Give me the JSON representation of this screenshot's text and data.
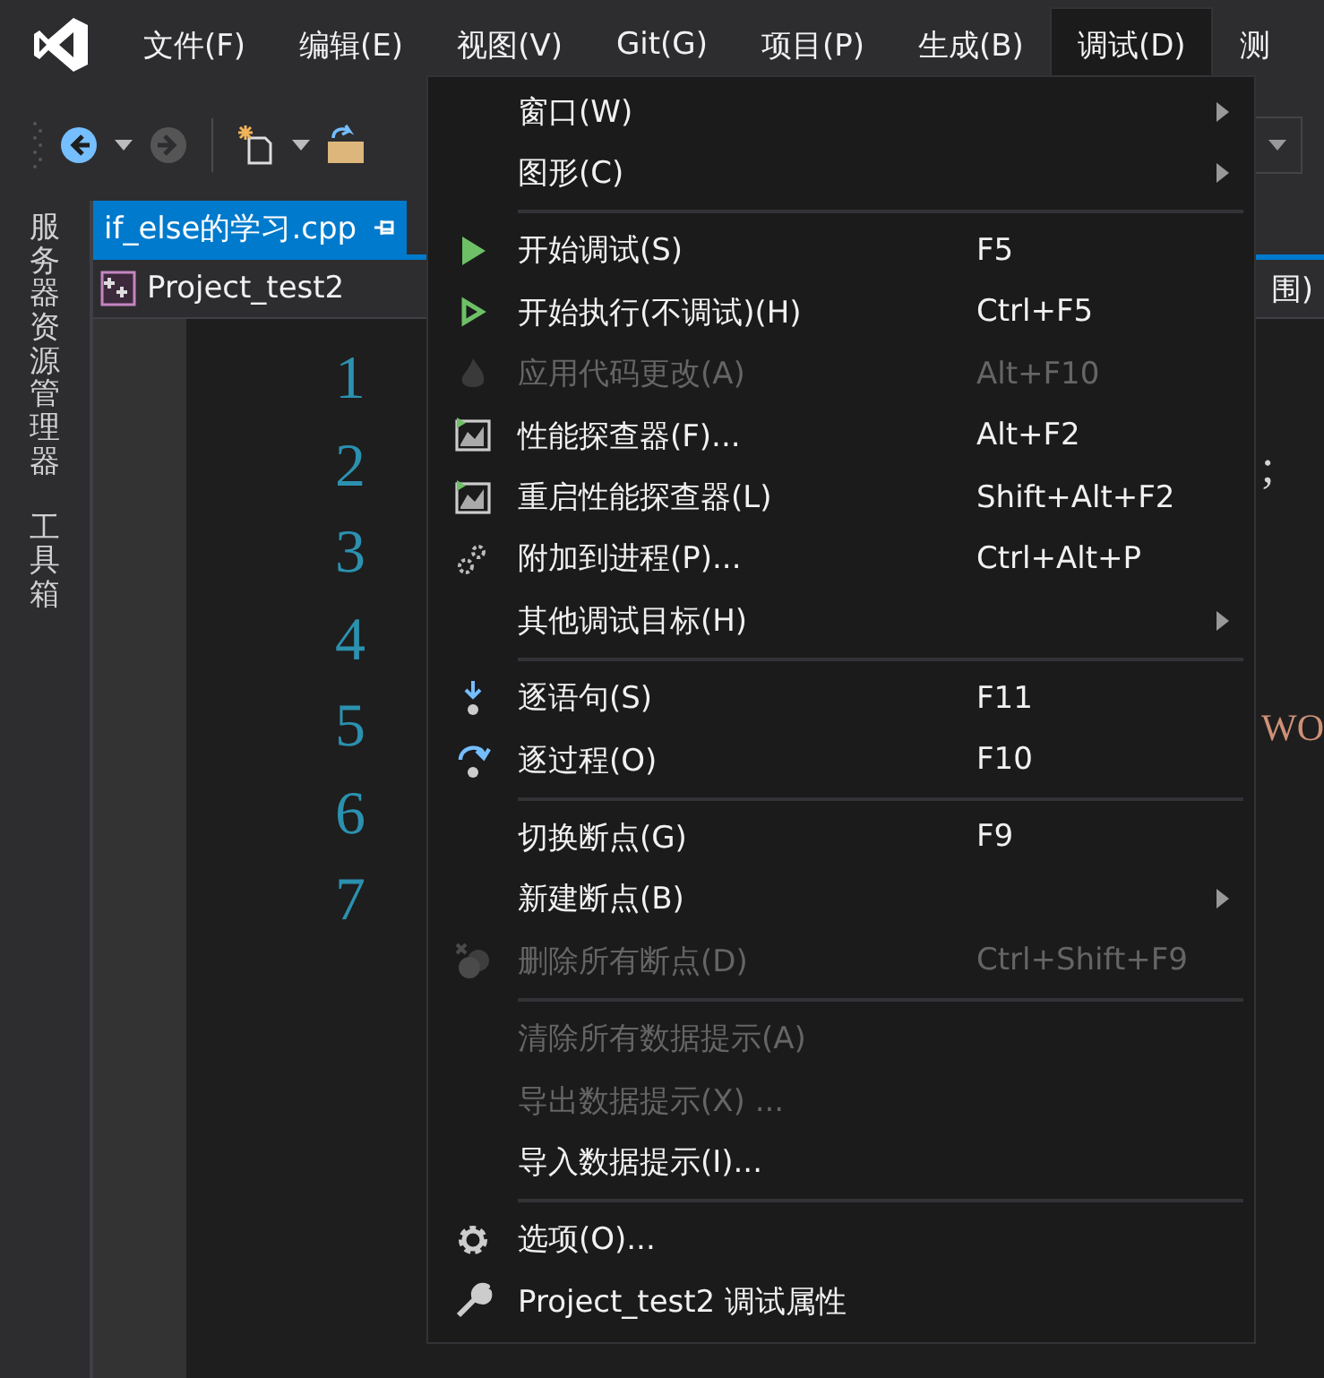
{
  "menu_bar": [
    {
      "label": "文件(F)",
      "selected": false
    },
    {
      "label": "编辑(E)",
      "selected": false
    },
    {
      "label": "视图(V)",
      "selected": false
    },
    {
      "label": "Git(G)",
      "selected": false
    },
    {
      "label": "项目(P)",
      "selected": false
    },
    {
      "label": "生成(B)",
      "selected": false
    },
    {
      "label": "调试(D)",
      "selected": true
    },
    {
      "label": "测",
      "selected": false
    }
  ],
  "side_tabs": [
    "服务器资源管理器",
    "工具箱"
  ],
  "document_tab": {
    "title": "if_else的学习.cpp",
    "selected": true
  },
  "nav_bar": {
    "project": "Project_test2",
    "scope": "围)"
  },
  "editor": {
    "lines": [
      {
        "number": "1"
      },
      {
        "number": "2",
        "text": ";"
      },
      {
        "number": "3"
      },
      {
        "number": "4"
      },
      {
        "number": "5",
        "text": "WO"
      },
      {
        "number": "6"
      },
      {
        "number": "7"
      }
    ]
  },
  "menu": {
    "items": [
      {
        "kind": "item",
        "label": "窗口(W)",
        "submenu": true,
        "disabled": false
      },
      {
        "kind": "item",
        "label": "图形(C)",
        "submenu": true,
        "disabled": false
      },
      {
        "kind": "separator"
      },
      {
        "kind": "item",
        "label": "开始调试(S)",
        "shortcut": "F5",
        "submenu": false,
        "disabled": false
      },
      {
        "kind": "item",
        "label": "开始执行(不调试)(H)",
        "shortcut": "Ctrl+F5",
        "submenu": false,
        "disabled": false
      },
      {
        "kind": "item",
        "label": "应用代码更改(A)",
        "shortcut": "Alt+F10",
        "submenu": false,
        "disabled": true
      },
      {
        "kind": "item",
        "label": "性能探查器(F)...",
        "shortcut": "Alt+F2",
        "submenu": false,
        "disabled": false
      },
      {
        "kind": "item",
        "label": "重启性能探查器(L)",
        "shortcut": "Shift+Alt+F2",
        "submenu": false,
        "disabled": false
      },
      {
        "kind": "item",
        "label": "附加到进程(P)...",
        "shortcut": "Ctrl+Alt+P",
        "submenu": false,
        "disabled": false
      },
      {
        "kind": "item",
        "label": "其他调试目标(H)",
        "submenu": true,
        "disabled": false
      },
      {
        "kind": "separator"
      },
      {
        "kind": "item",
        "label": "逐语句(S)",
        "shortcut": "F11",
        "submenu": false,
        "disabled": false
      },
      {
        "kind": "item",
        "label": "逐过程(O)",
        "shortcut": "F10",
        "submenu": false,
        "disabled": false
      },
      {
        "kind": "separator"
      },
      {
        "kind": "item",
        "label": "切换断点(G)",
        "shortcut": "F9",
        "submenu": false,
        "disabled": false
      },
      {
        "kind": "item",
        "label": "新建断点(B)",
        "submenu": true,
        "disabled": false
      },
      {
        "kind": "item",
        "label": "删除所有断点(D)",
        "shortcut": "Ctrl+Shift+F9",
        "submenu": false,
        "disabled": true
      },
      {
        "kind": "separator"
      },
      {
        "kind": "item",
        "label": "清除所有数据提示(A)",
        "submenu": false,
        "disabled": true
      },
      {
        "kind": "item",
        "label": "导出数据提示(X) ...",
        "submenu": false,
        "disabled": true
      },
      {
        "kind": "item",
        "label": "导入数据提示(I)...",
        "submenu": false,
        "disabled": false
      },
      {
        "kind": "separator"
      },
      {
        "kind": "item",
        "label": "选项(O)...",
        "submenu": false,
        "disabled": false
      },
      {
        "kind": "item",
        "label": "Project_test2 调试属性",
        "submenu": false,
        "disabled": false
      }
    ]
  }
}
